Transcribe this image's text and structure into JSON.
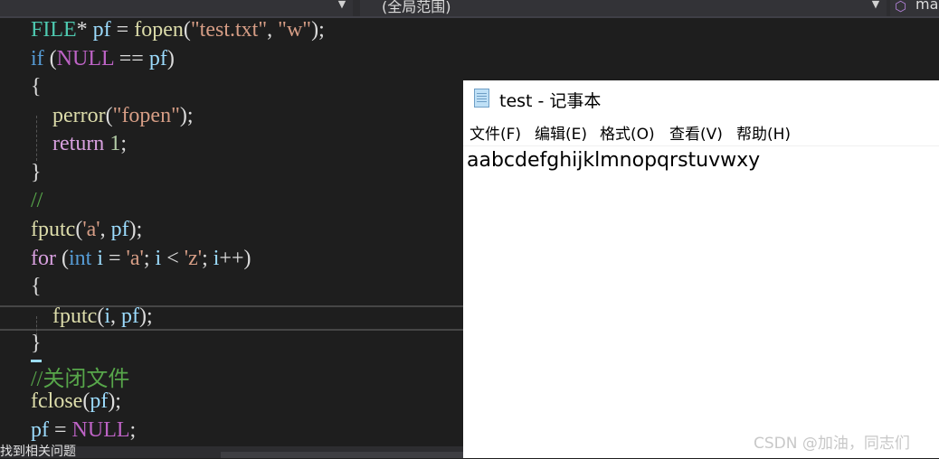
{
  "toolbar": {
    "scope_label": "(全局范围)",
    "project_label": "ma"
  },
  "editor": {
    "comment_empty": "//",
    "comment_close_file": "//关闭文件"
  },
  "bottom_panel": {
    "status_text": "找到相关问题"
  },
  "notepad": {
    "title": "test - 记事本",
    "menu": [
      {
        "label": "文件(F)"
      },
      {
        "label": "编辑(E)"
      },
      {
        "label": "格式(O)"
      },
      {
        "label": "查看(V)"
      },
      {
        "label": "帮助(H)"
      }
    ],
    "content": "aabcdefghijklmnopqrstuvwxy"
  },
  "watermark": "CSDN @加油，同志们"
}
